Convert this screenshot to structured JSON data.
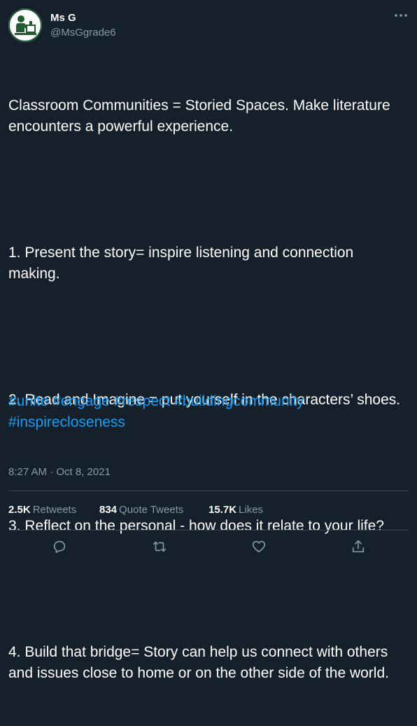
{
  "author": {
    "display_name": "Ms G",
    "handle": "@MsGgrade6",
    "avatar_icon": "classroom-teacher-avatar-icon"
  },
  "menu": {
    "icon": "more-horizontal-icon"
  },
  "tweet": {
    "lines": [
      "Classroom Communities = Storied Spaces. Make literature encounters a powerful experience.",
      "1. Present the story= inspire listening and connection making.",
      "2. Read and Imagine = put yourself in the characters’ shoes.",
      "3. Reflect on the personal - how does it relate to your life?",
      "4. Build that bridge= Story can help us connect with others and issues close to home or on the other side of the world."
    ],
    "hashtags": [
      "#unite",
      "#engage",
      "#respect",
      "#buildingcommunity",
      "#inspirecloseness"
    ],
    "timestamp": "8:27 AM · Oct 8, 2021"
  },
  "stats": {
    "retweets": {
      "count": "2.5K",
      "label": "Retweets"
    },
    "quotes": {
      "count": "834",
      "label": "Quote Tweets"
    },
    "likes": {
      "count": "15.7K",
      "label": "Likes"
    }
  },
  "actions": {
    "reply_icon": "reply-icon",
    "retweet_icon": "retweet-icon",
    "like_icon": "heart-icon",
    "share_icon": "share-icon"
  },
  "colors": {
    "background": "#15202b",
    "text": "#ffffff",
    "secondary": "#8899a6",
    "link": "#1d9bf0",
    "divider": "#38444d",
    "avatar_green": "#1f5d2e"
  }
}
